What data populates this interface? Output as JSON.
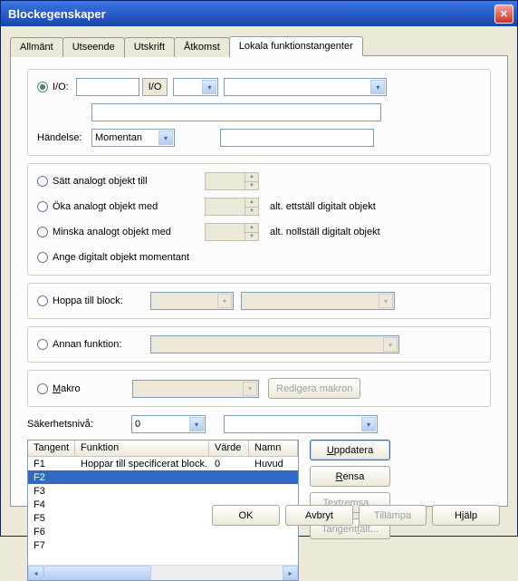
{
  "window": {
    "title": "Blockegenskaper"
  },
  "tabs": [
    "Allmänt",
    "Utseende",
    "Utskrift",
    "Åtkomst",
    "Lokala funktionstangenter"
  ],
  "active_tab": 4,
  "io": {
    "radio_label": "I/O:",
    "button_label": "I/O",
    "event_label": "Händelse:",
    "event_value": "Momentan"
  },
  "analog": {
    "opt1": "Sätt analogt objekt till",
    "opt2": "Öka analogt objekt med",
    "opt3": "Minska analogt objekt med",
    "opt4": "Ange digitalt objekt momentant",
    "alt1": "alt. ettställ digitalt objekt",
    "alt2": "alt. nollställ digitalt objekt"
  },
  "jump": {
    "label": "Hoppa till block:"
  },
  "other": {
    "label": "Annan funktion:"
  },
  "macro": {
    "label": "Makro",
    "edit_btn": "Redigera makron"
  },
  "security": {
    "label": "Säkerhetsnivå:",
    "value": "0"
  },
  "table": {
    "headers": {
      "key": "Tangent",
      "func": "Funktion",
      "val": "Värde",
      "name": "Namn"
    },
    "rows": [
      {
        "key": "F1",
        "func": "Hoppar till specificerat block.",
        "val": "0",
        "name": "Huvud"
      },
      {
        "key": "F2",
        "func": "",
        "val": "",
        "name": ""
      },
      {
        "key": "F3",
        "func": "",
        "val": "",
        "name": ""
      },
      {
        "key": "F4",
        "func": "",
        "val": "",
        "name": ""
      },
      {
        "key": "F5",
        "func": "",
        "val": "",
        "name": ""
      },
      {
        "key": "F6",
        "func": "",
        "val": "",
        "name": ""
      },
      {
        "key": "F7",
        "func": "",
        "val": "",
        "name": ""
      }
    ],
    "selected": 1
  },
  "side_buttons": {
    "update": "Uppdatera",
    "clear": "Rensa",
    "textstrip": "Textremsa...",
    "keyfield": "Tangentfält..."
  },
  "footer": {
    "ok": "OK",
    "cancel": "Avbryt",
    "apply": "Tillämpa",
    "help": "Hjälp"
  }
}
